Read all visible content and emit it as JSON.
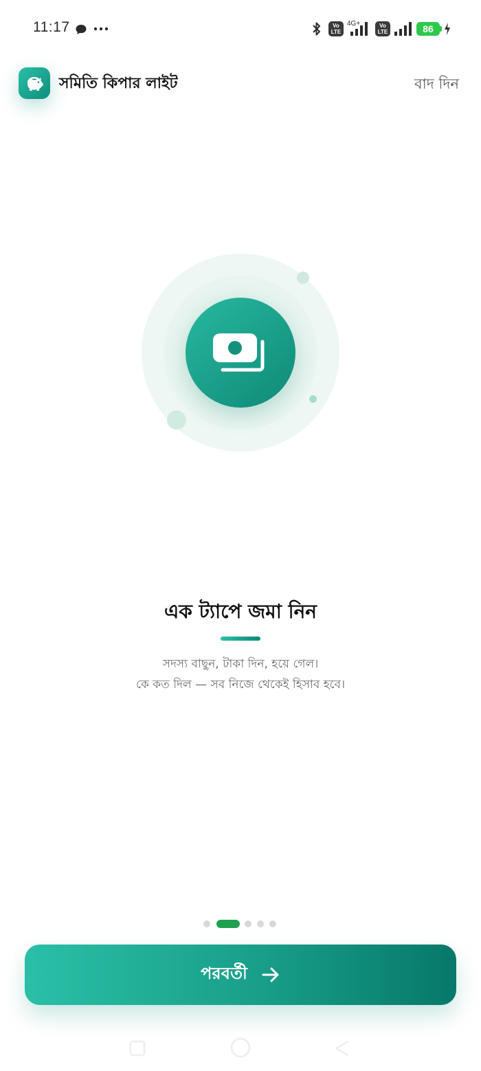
{
  "status_bar": {
    "time": "11:17",
    "network_type": "4G+",
    "volte_label_top": "Vo",
    "volte_label_bottom": "LTE",
    "battery_level": "86",
    "icons": [
      "chat-bubble-icon",
      "more-dots-icon",
      "bluetooth-icon",
      "volte-icon",
      "signal-icon",
      "battery-icon",
      "charging-icon"
    ]
  },
  "header": {
    "app_title": "সমিতি কিপার লাইট",
    "skip_label": "বাদ দিন",
    "logo_icon": "piggy-bank-icon"
  },
  "hero": {
    "icon": "cash-stack-icon"
  },
  "slide": {
    "title": "এক ট্যাপে জমা নিন",
    "description_line1": "সদস্য বাছুন, টাকা দিন, হয়ে গেল।",
    "description_line2": "কে কত দিল — সব নিজে থেকেই হিসাব হবে।"
  },
  "pager": {
    "total": 5,
    "active_index": 1
  },
  "footer": {
    "next_label": "পরবর্তী",
    "next_icon": "arrow-right-icon"
  },
  "colors": {
    "accent": "#1fa883",
    "accent_dark": "#07786a",
    "pager_active": "#1fa04f",
    "battery": "#2ec84d"
  }
}
